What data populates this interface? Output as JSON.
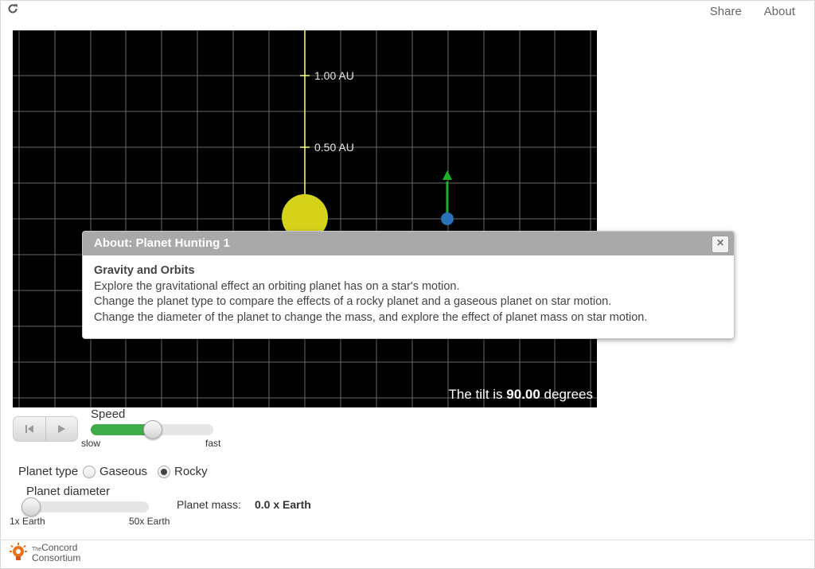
{
  "top_nav": {
    "share": "Share",
    "about": "About"
  },
  "simulation": {
    "scale_labels": [
      "1.00 AU",
      "0.50 AU"
    ],
    "tilt": {
      "prefix": "The tilt is ",
      "value": "90.00",
      "suffix": " degrees"
    },
    "colors": {
      "star": "#d6d21a",
      "axis": "#ffff88",
      "planet": "#2a72b8",
      "arrow": "#17b326",
      "grid": "#888888"
    }
  },
  "dialog": {
    "title": "About: Planet Hunting 1",
    "heading": "Gravity and Orbits",
    "lines": [
      "Explore the gravitational effect an orbiting planet has on a star's motion.",
      "Change the planet type to compare the effects of a rocky planet and a gaseous planet on star motion.",
      "Change the diameter of the planet to change the mass, and explore the effect of planet mass on star motion."
    ],
    "close": "×"
  },
  "controls": {
    "speed": {
      "label": "Speed",
      "min_label": "slow",
      "max_label": "fast",
      "value_fraction": 0.5
    },
    "planet_type": {
      "label": "Planet type",
      "options": [
        "Gaseous",
        "Rocky"
      ],
      "selected": "Rocky"
    },
    "planet_diameter": {
      "label": "Planet diameter",
      "min_label": "1x Earth",
      "max_label": "50x Earth",
      "value_fraction": 0.0
    },
    "planet_mass": {
      "label": "Planet mass:",
      "value": "0.0 x Earth"
    }
  },
  "footer": {
    "logo_the": "The",
    "logo_line1": "Concord",
    "logo_line2": "Consortium"
  }
}
